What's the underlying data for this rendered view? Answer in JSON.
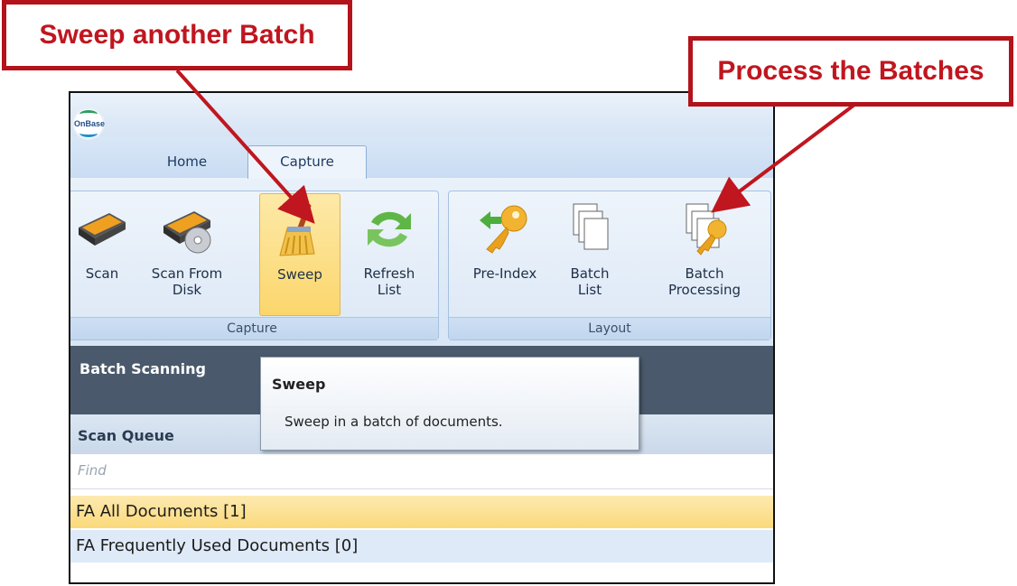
{
  "callouts": {
    "sweep": "Sweep another Batch",
    "process": "Process the Batches"
  },
  "app": {
    "logo_text": "OnBase"
  },
  "tabs": [
    {
      "label": "Home"
    },
    {
      "label": "Capture",
      "active": true
    }
  ],
  "ribbon": {
    "groups": [
      {
        "label": "Capture",
        "buttons": [
          {
            "label": "Scan",
            "icon": "scanner-icon"
          },
          {
            "label": "Scan From\nDisk",
            "icon": "scanner-disk-icon"
          },
          {
            "label": "Sweep",
            "icon": "broom-icon",
            "highlighted": true
          },
          {
            "label": "Refresh\nList",
            "icon": "refresh-icon"
          }
        ]
      },
      {
        "label": "Layout",
        "buttons": [
          {
            "label": "Pre-Index",
            "icon": "key-arrow-icon"
          },
          {
            "label": "Batch\nList",
            "icon": "pages-stack-icon"
          },
          {
            "label": "Batch\nProcessing",
            "icon": "pages-key-icon"
          }
        ]
      }
    ]
  },
  "tooltip": {
    "title": "Sweep",
    "description": "Sweep in a batch of documents."
  },
  "panel": {
    "header": "Batch Scanning",
    "queue_header": "Scan Queue",
    "find_placeholder": "Find",
    "queues": [
      {
        "label": "FA All Documents [1]",
        "selected": true
      },
      {
        "label": "FA Frequently Used Documents [0]"
      }
    ]
  },
  "colors": {
    "callout_red": "#b3131b",
    "highlight": "#fbd66c",
    "dark_bar": "#4a5a6c"
  }
}
